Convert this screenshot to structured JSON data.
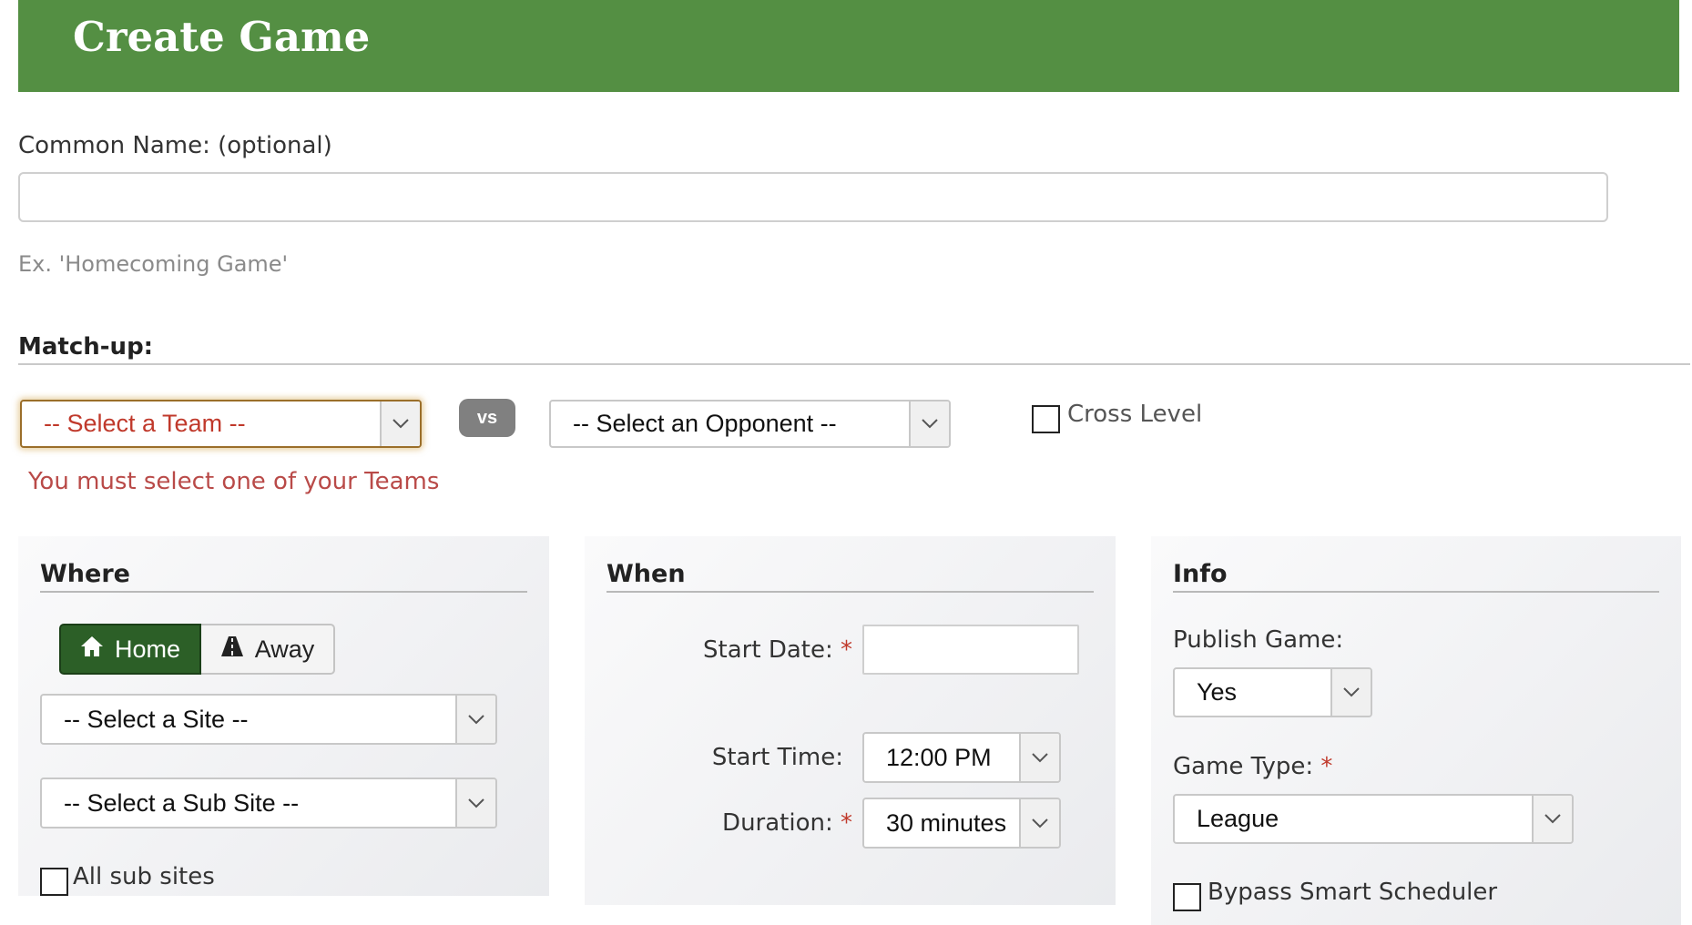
{
  "header": {
    "title": "Create Game"
  },
  "common_name": {
    "label": "Common Name: (optional)",
    "value": "",
    "placeholder": "",
    "hint": "Ex. 'Homecoming Game'"
  },
  "matchup": {
    "label": "Match-up:",
    "team_select": "-- Select a Team --",
    "vs": "vs",
    "opponent_select": "-- Select an Opponent --",
    "cross_level": "Cross Level",
    "error": "You must select one of your Teams"
  },
  "where": {
    "title": "Where",
    "home_label": "Home",
    "away_label": "Away",
    "site_select": "-- Select a Site --",
    "subsite_select": "-- Select a Sub Site --",
    "all_sub_sites": "All sub sites"
  },
  "when": {
    "title": "When",
    "start_date_label": "Start Date:",
    "start_date_value": "",
    "start_time_label": "Start Time:",
    "start_time_value": "12:00 PM",
    "duration_label": "Duration:",
    "duration_value": "30 minutes",
    "required_mark": "*"
  },
  "info": {
    "title": "Info",
    "publish_label": "Publish Game:",
    "publish_value": "Yes",
    "game_type_label": "Game Type:",
    "game_type_value": "League",
    "bypass_label": "Bypass Smart Scheduler",
    "required_mark": "*"
  },
  "colors": {
    "header_green": "#548f43",
    "home_active": "#2c5f27",
    "error_red": "#b94a48"
  }
}
